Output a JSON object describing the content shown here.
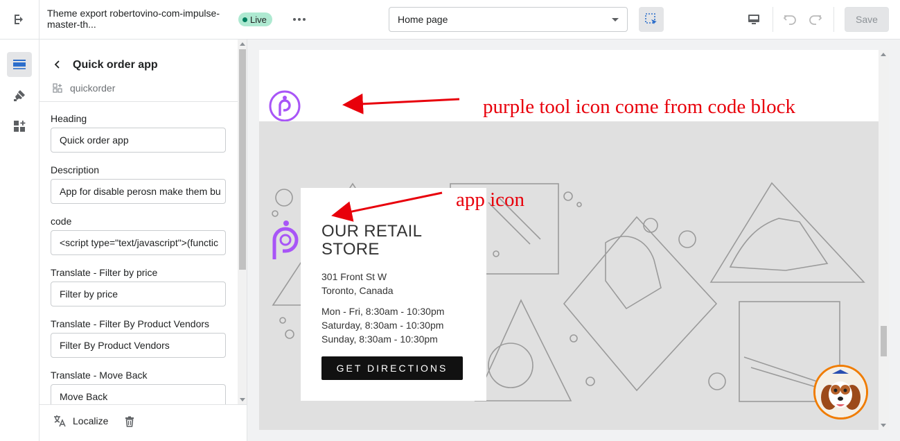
{
  "topbar": {
    "theme_name": "Theme export robertovino-com-impulse-master-th...",
    "status": "Live",
    "page_selector": "Home page",
    "save_label": "Save"
  },
  "panel": {
    "title": "Quick order app",
    "app_id": "quickorder",
    "fields": [
      {
        "label": "Heading",
        "value": "Quick order app"
      },
      {
        "label": "Description",
        "value": "App for disable perosn make them bu"
      },
      {
        "label": "code",
        "value": "<script type=\"text/javascript\">(functic"
      },
      {
        "label": "Translate - Filter by price",
        "value": "Filter by price"
      },
      {
        "label": "Translate - Filter By Product Vendors",
        "value": "Filter By Product Vendors"
      },
      {
        "label": "Translate - Move Back",
        "value": "Move Back"
      }
    ],
    "localize_label": "Localize"
  },
  "preview": {
    "store_title": "OUR RETAIL STORE",
    "address_line1": "301 Front St W",
    "address_line2": "Toronto, Canada",
    "hours": [
      "Mon - Fri, 8:30am - 10:30pm",
      "Saturday, 8:30am - 10:30pm",
      "Sunday, 8:30am - 10:30pm"
    ],
    "directions_label": "GET DIRECTIONS"
  },
  "annotations": {
    "top": "purple tool icon come from code block",
    "bottom": "app icon"
  },
  "colors": {
    "brand_purple": "#a855f7",
    "annotation_red": "#e8000b",
    "live_green": "#aee9d1"
  },
  "icons": [
    "exit-icon",
    "more-icon",
    "inspect-icon",
    "desktop-icon",
    "undo-icon",
    "redo-icon",
    "sections-icon",
    "theme-settings-icon",
    "app-blocks-icon",
    "back-icon",
    "app-block-icon",
    "localize-icon",
    "delete-icon",
    "accessibility-logo-icon"
  ]
}
